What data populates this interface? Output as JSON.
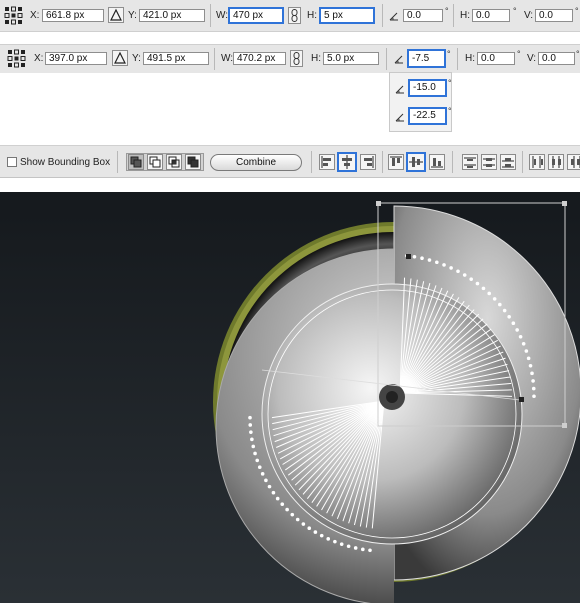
{
  "transform_bar_1": {
    "x_label": "X:",
    "x_value": "661.8 px",
    "y_label": "Y:",
    "y_value": "421.0 px",
    "w_label": "W:",
    "w_value": "470 px",
    "h_label": "H:",
    "h_value": "5 px",
    "rotate_value": "0.0",
    "rotate_unit": "°",
    "shear_h_label": "H:",
    "shear_h_value": "0.0",
    "shear_h_unit": "°",
    "shear_v_label": "V:",
    "shear_v_value": "0.0",
    "shear_v_unit": "°"
  },
  "transform_bar_2": {
    "x_label": "X:",
    "x_value": "397.0 px",
    "y_label": "Y:",
    "y_value": "491.5 px",
    "w_label": "W:",
    "w_value": "470.2 px",
    "h_label": "H:",
    "h_value": "5.0 px",
    "rotate_value": "-7.5",
    "rotate_unit": "°",
    "shear_h_label": "H:",
    "shear_h_value": "0.0",
    "shear_h_unit": "°",
    "shear_v_label": "V:",
    "shear_v_value": "0.0",
    "shear_v_unit": "°"
  },
  "rotate_dropdown": {
    "options": [
      {
        "value": "-15.0",
        "unit": "°"
      },
      {
        "value": "-22.5",
        "unit": "°"
      }
    ]
  },
  "toolbar": {
    "show_bounding_box_label": "Show Bounding Box",
    "combine_label": "Combine"
  },
  "colors": {
    "highlight": "#2f73d8",
    "panel": "#e6e6e6",
    "canvas_top": "#15191d",
    "canvas_bottom": "#2a3035",
    "ring_accent": "#6f7a2c"
  },
  "icons": [
    "reference-point-icon",
    "link-proportions-icon",
    "triangle-icon",
    "angle-icon",
    "shape-mode-icon",
    "align-icon",
    "distribute-icon"
  ]
}
